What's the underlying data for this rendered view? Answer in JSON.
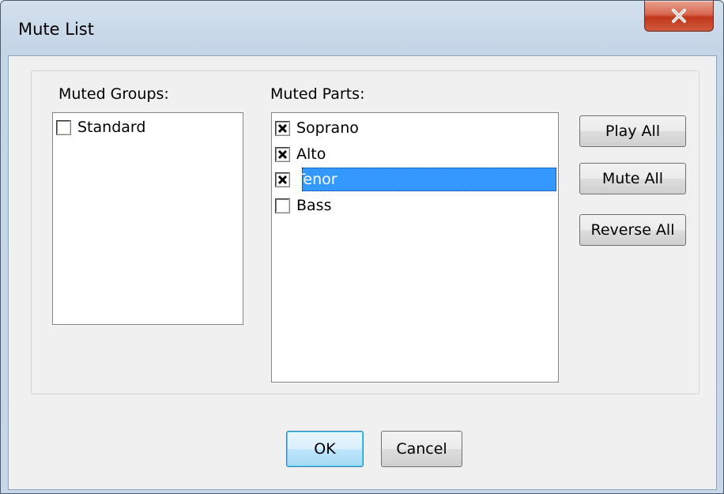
{
  "window": {
    "title": "Mute List",
    "close_label": "X"
  },
  "muted_groups": {
    "label": "Muted Groups:",
    "items": [
      {
        "label": "Standard",
        "checked": false
      }
    ]
  },
  "muted_parts": {
    "label": "Muted Parts:",
    "items": [
      {
        "label": "Soprano",
        "checked": true,
        "selected": false
      },
      {
        "label": "Alto",
        "checked": true,
        "selected": false
      },
      {
        "label": "Tenor",
        "checked": true,
        "selected": true
      },
      {
        "label": "Bass",
        "checked": false,
        "selected": false
      }
    ]
  },
  "side_buttons": {
    "play_all": "Play All",
    "mute_all": "Mute All",
    "reverse_all": "Reverse All"
  },
  "footer": {
    "ok": "OK",
    "cancel": "Cancel"
  },
  "colors": {
    "selection": "#3399ff",
    "close_button": "#c7432a"
  }
}
